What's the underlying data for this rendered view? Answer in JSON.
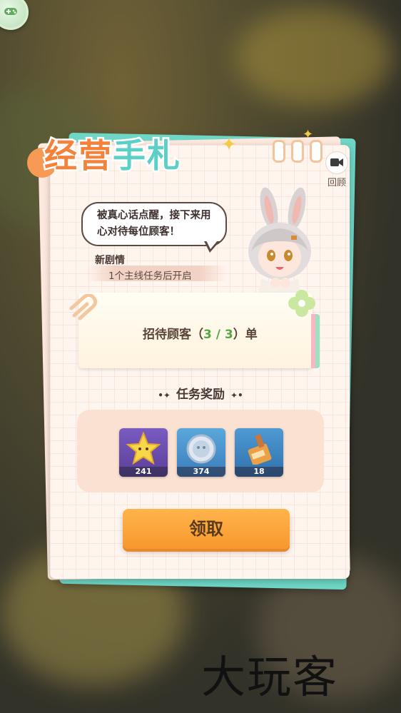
{
  "notebook": {
    "title_part1": "经营",
    "title_part2": "手札",
    "replay_label": "回顾"
  },
  "dialogue": {
    "line1": "被真心话点醒，接下来用",
    "line2": "心对待每位顾客！"
  },
  "story": {
    "label": "新剧情",
    "unlock_text": "1个主线任务后开启"
  },
  "task": {
    "prefix": "招待顾客（",
    "progress": "3 / 3",
    "suffix": "）单"
  },
  "rewards": {
    "section_title": "任务奖励",
    "items": [
      {
        "icon": "star-icon",
        "count": "241",
        "bg": "#6a4fa8"
      },
      {
        "icon": "coin-icon",
        "count": "374",
        "bg": "#3e8ec8"
      },
      {
        "icon": "bottle-icon",
        "count": "18",
        "bg": "#3a82bc"
      }
    ]
  },
  "actions": {
    "claim_label": "领取"
  },
  "watermark": "大玩客",
  "colors": {
    "accent_orange": "#f7982e",
    "title_orange": "#f5823a",
    "title_teal": "#5ccfc6",
    "progress_green": "#52a843"
  }
}
